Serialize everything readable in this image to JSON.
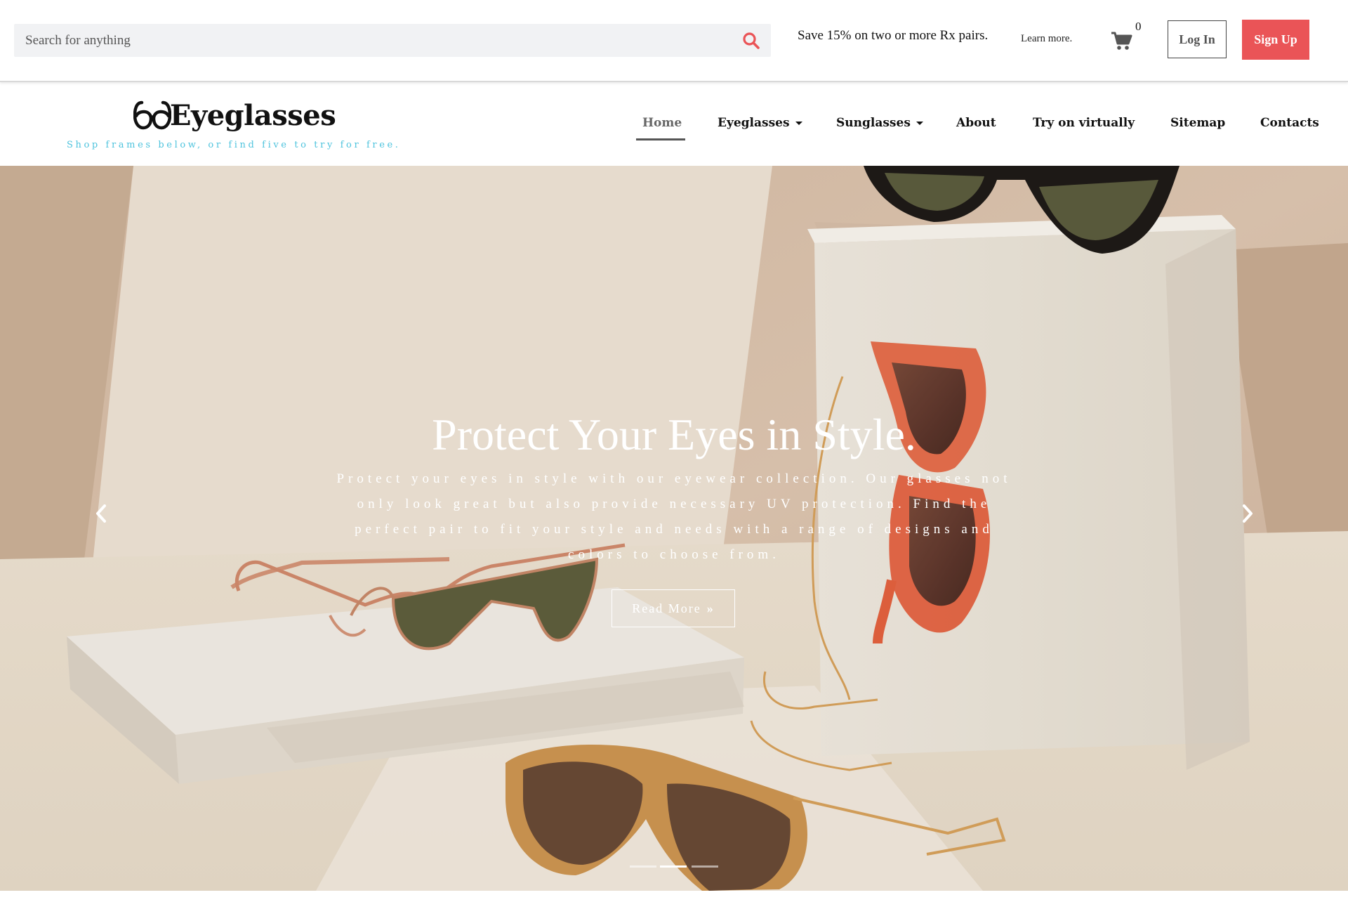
{
  "topbar": {
    "search_placeholder": "Search for anything",
    "promo_text": "Save 15% on two or more Rx pairs.",
    "learn_more": "Learn more.",
    "cart_count": "0",
    "login_label": "Log In",
    "signup_label": "Sign Up",
    "accent_color": "#ea5457",
    "search_icon": "search-icon",
    "cart_icon": "cart-icon"
  },
  "brand": {
    "name": "Eyeglasses",
    "tagline": "Shop frames below, or find five to try for free.",
    "logo_icon": "glasses-icon",
    "tagline_color": "#4dc3dd"
  },
  "nav": {
    "items": [
      {
        "label": "Home",
        "active": true
      },
      {
        "label": "Eyeglasses",
        "dropdown": true
      },
      {
        "label": "Sunglasses",
        "dropdown": true
      },
      {
        "label": "About"
      },
      {
        "label": "Try on virtually"
      },
      {
        "label": "Sitemap"
      },
      {
        "label": "Contacts"
      }
    ]
  },
  "hero": {
    "title": "Protect Your Eyes in Style.",
    "description": "Protect your eyes in style with our eyewear collection. Our glasses not only look great but also provide necessary UV protection. Find the perfect pair to fit your style and needs with a range of designs and colors to choose from.",
    "button_label": "Read More",
    "slides_total": 3,
    "active_slide": 2
  }
}
